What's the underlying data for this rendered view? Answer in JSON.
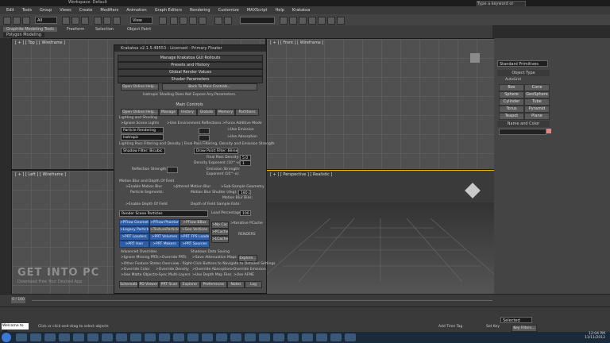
{
  "window": {
    "title": "Workspace: Default",
    "search_placeholder": "Type a keyword or phrase"
  },
  "menu": [
    "Edit",
    "Tools",
    "Group",
    "Views",
    "Create",
    "Modifiers",
    "Animation",
    "Graph Editors",
    "Rendering",
    "Customize",
    "MAXScript",
    "Help",
    "Krakatoa"
  ],
  "toolbar": {
    "selection_filter": "All",
    "view_dropdown": "View"
  },
  "ribbon": {
    "tabs": [
      "Graphite Modeling Tools",
      "Freeform",
      "Selection",
      "Object Paint"
    ],
    "subtab": "Polygon Modeling"
  },
  "viewports": {
    "top": "[ + ] [ Top ] [ Wireframe ]",
    "front": "[ + ] [ Front ] [ Wireframe ]",
    "left": "[ + ] [ Left ] [ Wireframe ]",
    "perspective": "[ + ] [ Perspective ] [ Realistic ]"
  },
  "command_panel": {
    "dropdown": "Standard Primitives",
    "object_type_title": "Object Type",
    "autogrid": "AutoGrid",
    "buttons": [
      "Box",
      "Cone",
      "Sphere",
      "GeoSphere",
      "Cylinder",
      "Tube",
      "Torus",
      "Pyramid",
      "Teapot",
      "Plane"
    ],
    "name_color_title": "Name and Color"
  },
  "dialog": {
    "title": "Krakatoa v2.1.5.49553 - Licensed - Primary Floater",
    "rollouts": [
      "Manage Krakatoa GUI Rollouts",
      "Presets and History",
      "Global Render Values",
      "Shader Parameters"
    ],
    "open_help": "Open Online Help...",
    "back_to_main": "Back To Main Controls...",
    "isotropic_note": "Isotropic Shading Does Not Expose Any Parameters.",
    "main_controls": "Main Controls",
    "main_tabs": [
      "Open Online Help...",
      "Manage",
      "History",
      "Globals",
      "Memory",
      "Partitions"
    ],
    "lighting_title": "Lighting and Shading",
    "ignore_scene_lights": ">Ignore Scene Lights",
    "use_env_reflections": ">Use Environment Reflections",
    "force_additive": ">Force Additive Mode",
    "render_mode": "Particle Rendering",
    "shading": "Isotropic",
    "use_emission": ">Use Emission",
    "use_absorption": ">Use Absorption",
    "lighting_pass_title": "Lighting Pass Filtering and Density  |  Final Pass Filtering, Density and Emission Strength",
    "shadow_filter": "Shadow Filter: Bicubic",
    "draw_filter": "Draw Point Filter: Bilinear",
    "final_pass_density": "Final Pass Density:",
    "final_pass_density_value": "5.0",
    "density_exponent": "Density Exponent (10^-x):",
    "density_exponent_value": "1",
    "reflection_strength": "Reflection Strength:",
    "emission_strength": "Emission Strength:",
    "exponent": "Exponent (10^-x):",
    "motion_blur_title": "Motion Blur and Depth Of Field",
    "enable_motion_blur": ">Enable Motion Blur",
    "jittered_blur": ">Jittered Motion Blur",
    "sub_sample_geometry": ">Sub-Sample Geometry",
    "particle_segments": "Particle Segments:",
    "motion_blur_shutter": "Motion Blur Shutter (deg):",
    "motion_blur_shutter_value": "180.0",
    "motion_blur_bias": "Motion Blur Bias:",
    "enable_dof": ">Enable Depth Of Field",
    "dof_sample_rate": "Depth of Field Sample Rate:",
    "render_mode_select": "Render Scene Particles",
    "load_percentage": "Load Percentage:",
    "load_percentage_value": "100.0",
    "sources": [
      ">PFlow Geometry",
      ">PFlow Phantom",
      ">PFlow BBox",
      ">Legacy Particles",
      ">TextureParticles",
      ">Geo Vertices",
      ">PRT Loaders",
      ">PRT Volumes",
      ">PRT FPS Loader",
      ">PRT Hair",
      ">PRT Makers",
      ">PRT Sources"
    ],
    "no_cache": ">No Cache",
    "pcache": ">PCache",
    "lcache": ">LCache",
    "iterative_pcache": ">Iterative PCache",
    "renders": "RENDERS",
    "advanced_title": "Advanced Overrides",
    "shadow_title": "Shadows Data Saving",
    "ignore_prt": ">Ignore Missing PRTs",
    "override_prt": ">Override PRTs",
    "save_attenuation": ">Save Attenuation Maps",
    "explore": "Explore...",
    "other_features_note": ">Other Feature States Overview - Right-Click Buttons to Navigate to Detailed Settings",
    "override_color": ">Override Color",
    "override_density": ">Override Density",
    "override_absorption": ">Override Absorption",
    "override_emission": ">Override Emission",
    "use_matte": ">Use Matte Objects",
    "sync_multi_layers": ">Sync Multi-Layers",
    "use_depth_map": ">Use Depth Map Files",
    "use_afme": ">Use AFME",
    "bottom_tabs": [
      "Schematic",
      "PD Viewer",
      "PRT Scan",
      "Explorer",
      "Preferences",
      "Notes",
      "Log"
    ]
  },
  "timeline": {
    "frame": "0 / 100"
  },
  "statusbar": {
    "welcome": "Welcome to MA",
    "prompt": "Click or click-and-drag to select objects",
    "selected": "Selected",
    "key_filters": "Key Filters...",
    "add_time_tag": "Add Time Tag",
    "set_key": "Set Key"
  },
  "watermark": {
    "line1": "GET INTO PC",
    "line2": "Download Free Your Desired App"
  },
  "taskbar": {
    "time": "12:04 PM",
    "date": "11/11/2012"
  }
}
